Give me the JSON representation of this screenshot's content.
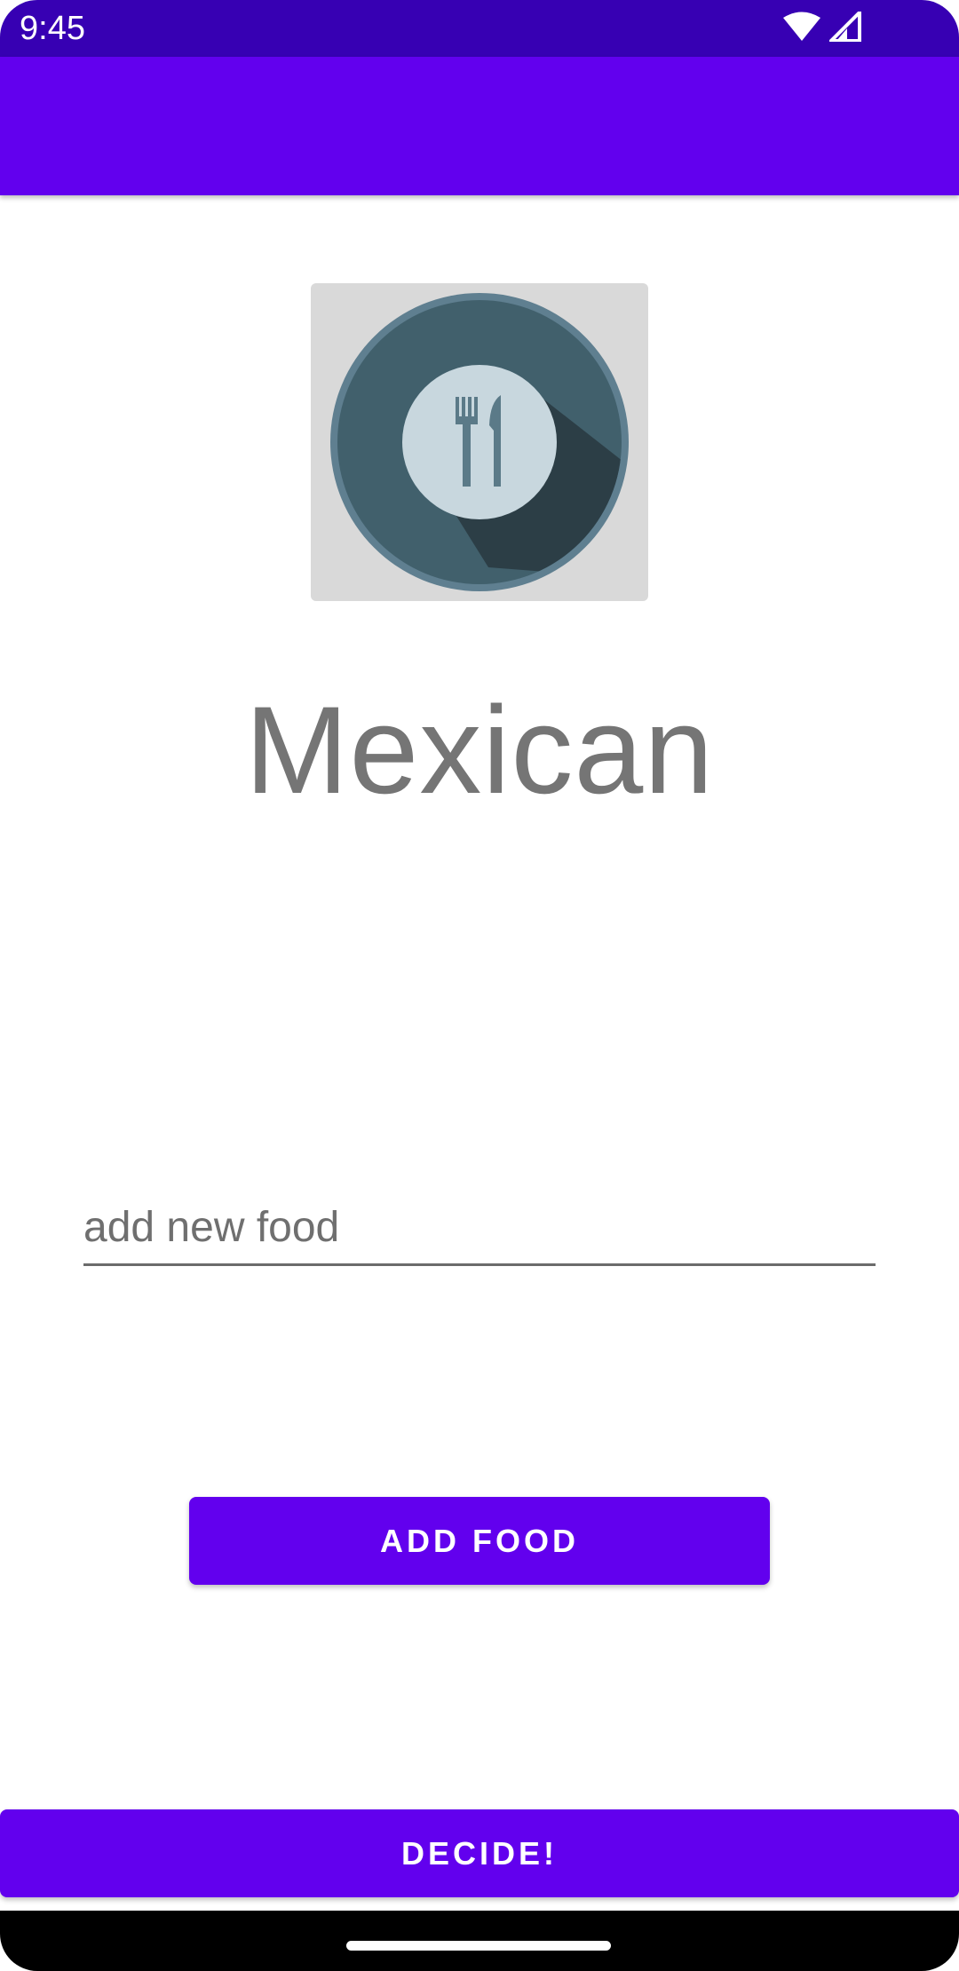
{
  "status_bar": {
    "time": "9:45",
    "icons": [
      "wifi-icon",
      "signal-icon"
    ]
  },
  "main": {
    "image_icon": "fork-knife-plate-icon",
    "food_name": "Mexican",
    "input": {
      "value": "",
      "placeholder": "add new food"
    },
    "add_button_label": "ADD FOOD",
    "decide_button_label": "DECIDE!"
  },
  "colors": {
    "primary": "#6200EE",
    "primary_dark": "#3700B3",
    "title_text": "#757575"
  }
}
